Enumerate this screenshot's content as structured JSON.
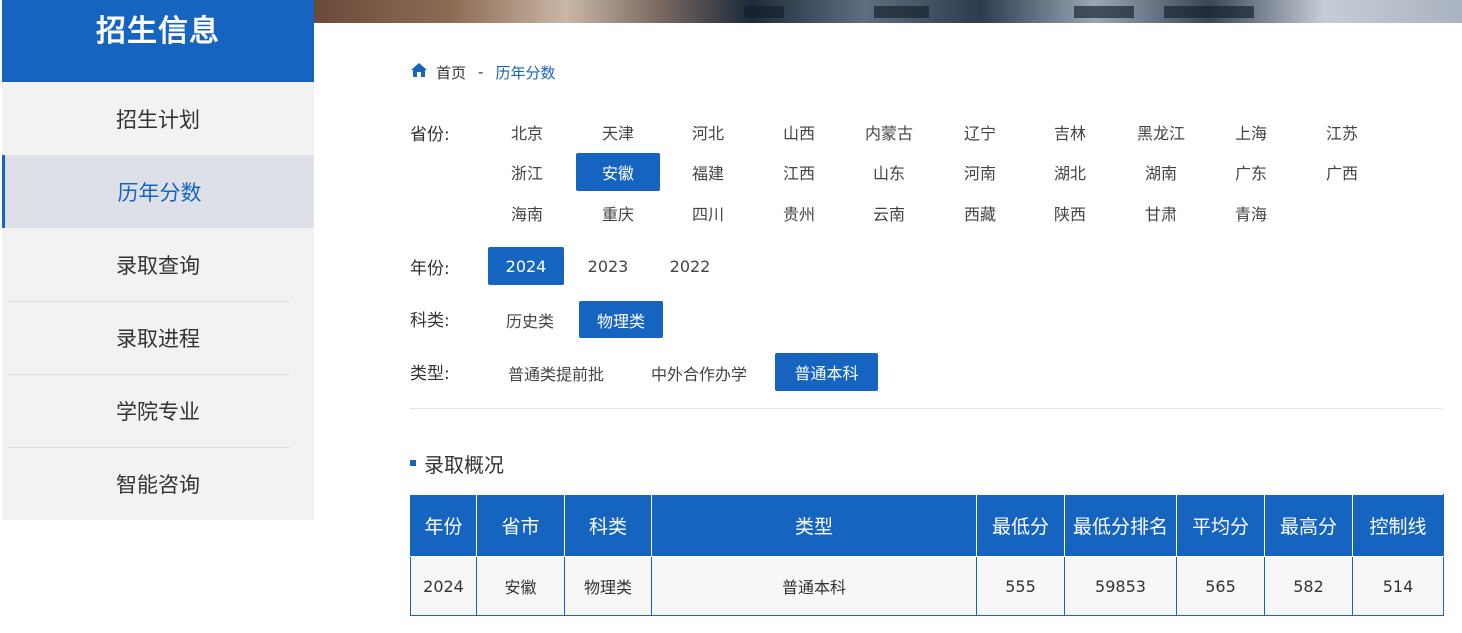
{
  "sidebar": {
    "title": "招生信息",
    "items": [
      {
        "label": "招生计划",
        "active": false
      },
      {
        "label": "历年分数",
        "active": true
      },
      {
        "label": "录取查询",
        "active": false
      },
      {
        "label": "录取进程",
        "active": false
      },
      {
        "label": "学院专业",
        "active": false
      },
      {
        "label": "智能咨询",
        "active": false
      }
    ]
  },
  "breadcrumb": {
    "home": "首页",
    "sep": "-",
    "current": "历年分数",
    "icon": "home-icon"
  },
  "filters": {
    "province_label": "省份:",
    "provinces": [
      "北京",
      "天津",
      "河北",
      "山西",
      "内蒙古",
      "辽宁",
      "吉林",
      "黑龙江",
      "上海",
      "江苏",
      "浙江",
      "安徽",
      "福建",
      "江西",
      "山东",
      "河南",
      "湖北",
      "湖南",
      "广东",
      "广西",
      "海南",
      "重庆",
      "四川",
      "贵州",
      "云南",
      "西藏",
      "陕西",
      "甘肃",
      "青海"
    ],
    "province_selected": "安徽",
    "year_label": "年份:",
    "years": [
      "2024",
      "2023",
      "2022"
    ],
    "year_selected": "2024",
    "subject_label": "科类:",
    "subjects": [
      "历史类",
      "物理类"
    ],
    "subject_selected": "物理类",
    "type_label": "类型:",
    "types": [
      "普通类提前批",
      "中外合作办学",
      "普通本科"
    ],
    "type_selected": "普通本科"
  },
  "section": {
    "title": "录取概况"
  },
  "table": {
    "headers": [
      "年份",
      "省市",
      "科类",
      "类型",
      "最低分",
      "最低分排名",
      "平均分",
      "最高分",
      "控制线"
    ],
    "rows": [
      [
        "2024",
        "安徽",
        "物理类",
        "普通本科",
        "555",
        "59853",
        "565",
        "582",
        "514"
      ]
    ]
  },
  "colors": {
    "accent": "#1565c0"
  }
}
